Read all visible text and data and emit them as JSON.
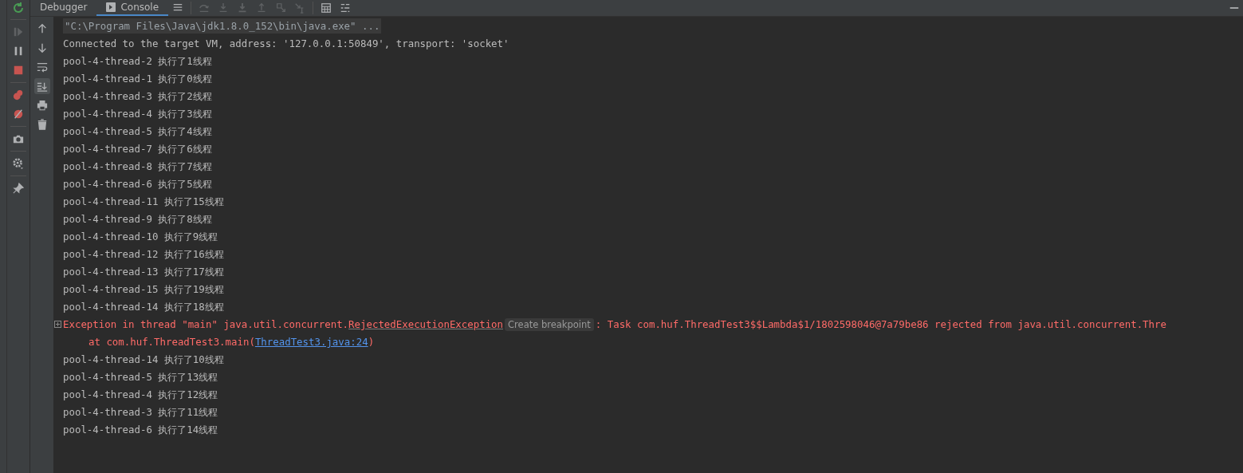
{
  "tabs": [
    {
      "label": "Debugger",
      "selected": false,
      "icon": false
    },
    {
      "label": "Console",
      "selected": true,
      "icon": true
    }
  ],
  "top_toolbar": [
    {
      "kind": "menu",
      "disabled": false
    },
    {
      "kind": "step-over",
      "disabled": true
    },
    {
      "kind": "step-into",
      "disabled": true
    },
    {
      "kind": "force-step-into",
      "disabled": true
    },
    {
      "kind": "step-out",
      "disabled": true
    },
    {
      "kind": "drop-frame",
      "disabled": true
    },
    {
      "kind": "run-to-cursor",
      "disabled": true
    },
    {
      "kind": "evaluate",
      "disabled": false
    },
    {
      "kind": "trace",
      "disabled": false
    }
  ],
  "debug_toolbar": [
    {
      "kind": "resume",
      "disabled": true
    },
    {
      "kind": "pause",
      "disabled": false
    },
    {
      "kind": "stop",
      "disabled": false
    },
    {
      "kind": "breakpoints",
      "disabled": false
    },
    {
      "kind": "mute",
      "disabled": false
    },
    {
      "kind": "camera",
      "disabled": false
    },
    {
      "kind": "settings",
      "disabled": false
    },
    {
      "kind": "pin",
      "disabled": false
    }
  ],
  "console_toolbar": [
    {
      "kind": "up",
      "on": false
    },
    {
      "kind": "down",
      "on": false
    },
    {
      "kind": "wrap",
      "on": false
    },
    {
      "kind": "scroll-end",
      "on": true
    },
    {
      "kind": "print",
      "on": false
    },
    {
      "kind": "trash",
      "on": false
    }
  ],
  "lines": [
    {
      "kind": "command",
      "text": "\"C:\\Program Files\\Java\\jdk1.8.0_152\\bin\\java.exe\" ..."
    },
    {
      "kind": "output",
      "text": "Connected to the target VM, address: '127.0.0.1:50849', transport: 'socket'"
    },
    {
      "kind": "output",
      "text": "pool-4-thread-2 执行了1线程"
    },
    {
      "kind": "output",
      "text": "pool-4-thread-1 执行了0线程"
    },
    {
      "kind": "output",
      "text": "pool-4-thread-3 执行了2线程"
    },
    {
      "kind": "output",
      "text": "pool-4-thread-4 执行了3线程"
    },
    {
      "kind": "output",
      "text": "pool-4-thread-5 执行了4线程"
    },
    {
      "kind": "output",
      "text": "pool-4-thread-7 执行了6线程"
    },
    {
      "kind": "output",
      "text": "pool-4-thread-8 执行了7线程"
    },
    {
      "kind": "output",
      "text": "pool-4-thread-6 执行了5线程"
    },
    {
      "kind": "output",
      "text": "pool-4-thread-11 执行了15线程"
    },
    {
      "kind": "output",
      "text": "pool-4-thread-9 执行了8线程"
    },
    {
      "kind": "output",
      "text": "pool-4-thread-10 执行了9线程"
    },
    {
      "kind": "output",
      "text": "pool-4-thread-12 执行了16线程"
    },
    {
      "kind": "output",
      "text": "pool-4-thread-13 执行了17线程"
    },
    {
      "kind": "output",
      "text": "pool-4-thread-15 执行了19线程"
    },
    {
      "kind": "output",
      "text": "pool-4-thread-14 执行了18线程"
    },
    {
      "kind": "exception",
      "expanded": false,
      "prefix": "Exception in thread \"main\" java.util.concurrent.",
      "link": "RejectedExecutionException",
      "hint": "Create breakpoint",
      "suffix": ": Task com.huf.ThreadTest3$$Lambda$1/1802598046@7a79be86 rejected from java.util.concurrent.Thre"
    },
    {
      "kind": "stack",
      "prefix": "at com.huf.ThreadTest3.main(",
      "link": "ThreadTest3.java:24",
      "suffix": ")"
    },
    {
      "kind": "output",
      "text": "pool-4-thread-14 执行了10线程"
    },
    {
      "kind": "output",
      "text": "pool-4-thread-5 执行了13线程"
    },
    {
      "kind": "output",
      "text": "pool-4-thread-4 执行了12线程"
    },
    {
      "kind": "output",
      "text": "pool-4-thread-3 执行了11线程"
    },
    {
      "kind": "output",
      "text": "pool-4-thread-6 执行了14线程"
    }
  ]
}
